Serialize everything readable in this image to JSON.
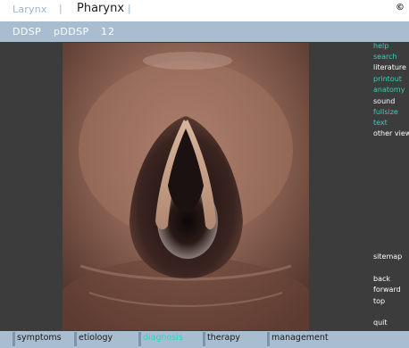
{
  "header": {
    "tabs": [
      {
        "label": "Larynx",
        "state": "inactive"
      },
      {
        "label": "Pharynx",
        "state": "active"
      }
    ],
    "separators": [
      "|",
      "|"
    ],
    "copyright": "©"
  },
  "subnav": {
    "items": [
      "DDSP",
      "pDDSP"
    ],
    "pages": [
      "1",
      "2"
    ]
  },
  "right_menu": {
    "items": [
      {
        "label": "help",
        "style": "link"
      },
      {
        "label": "search",
        "style": "link"
      },
      {
        "label": "literature",
        "style": "plain"
      },
      {
        "label": "printout",
        "style": "link"
      },
      {
        "label": "anatomy",
        "style": "link"
      },
      {
        "label": "sound",
        "style": "plain"
      },
      {
        "label": "fullsize",
        "style": "link"
      },
      {
        "label": "text",
        "style": "link"
      },
      {
        "label": "other view",
        "style": "plain"
      },
      {
        "label": "sitemap",
        "style": "plain"
      },
      {
        "label": "back",
        "style": "plain"
      },
      {
        "label": "forward",
        "style": "plain"
      },
      {
        "label": "top",
        "style": "plain"
      },
      {
        "label": "quit",
        "style": "plain"
      }
    ]
  },
  "bottom_nav": {
    "items": [
      {
        "label": "symptoms",
        "state": "normal"
      },
      {
        "label": "etiology",
        "state": "normal"
      },
      {
        "label": "diagnosis",
        "state": "active"
      },
      {
        "label": "therapy",
        "state": "normal"
      },
      {
        "label": "management",
        "state": "normal"
      }
    ]
  },
  "colors": {
    "accent_link": "#2fd4b8",
    "bar": "#a9bdd1",
    "stage": "#3c3c3c"
  }
}
